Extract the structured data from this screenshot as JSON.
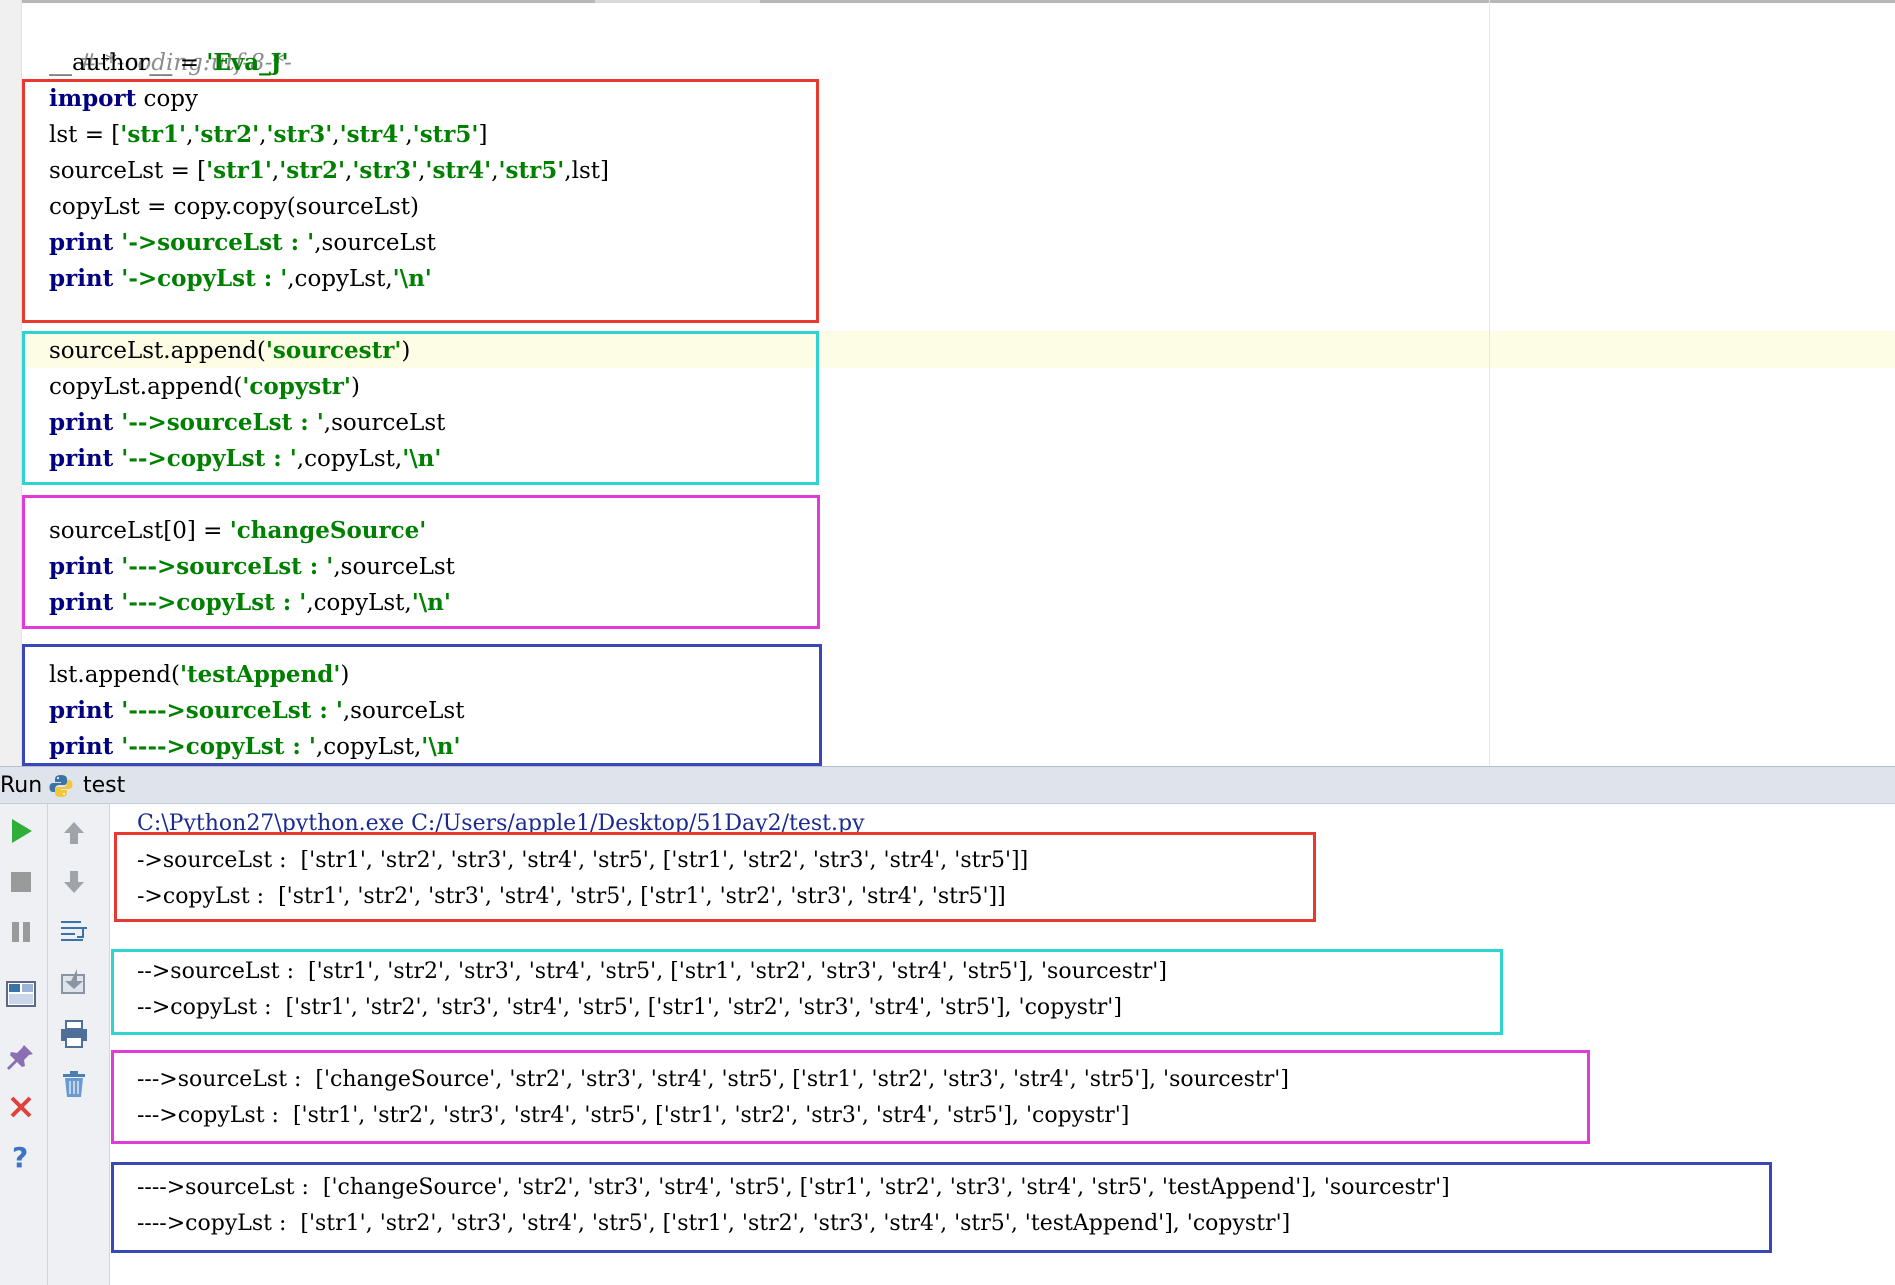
{
  "editor": {
    "line1": "#-*-coding:utf-8-*-",
    "line2": {
      "ident": "__author__ = ",
      "string": "'Eva_J'"
    },
    "block1": {
      "l1": {
        "kw": "import",
        "rest": " copy"
      },
      "l2": {
        "a": "lst = [",
        "s1": "'str1'",
        "c1": ",",
        "s2": "'str2'",
        "c2": ",",
        "s3": "'str3'",
        "c3": ",",
        "s4": "'str4'",
        "c4": ",",
        "s5": "'str5'",
        "b": "]"
      },
      "l3": {
        "a": "sourceLst = [",
        "s1": "'str1'",
        "c1": ",",
        "s2": "'str2'",
        "c2": ",",
        "s3": "'str3'",
        "c3": ",",
        "s4": "'str4'",
        "c4": ",",
        "s5": "'str5'",
        "b": ",lst]"
      },
      "l4": "copyLst = copy.copy(sourceLst)",
      "l5": {
        "kw": "print",
        "str": " '->sourceLst : '",
        "rest": ",sourceLst"
      },
      "l6": {
        "kw": "print",
        "str": " '->copyLst : '",
        "rest": ",copyLst,",
        "nl": "'\\n'"
      }
    },
    "block2": {
      "l1": {
        "a": "sourceLst.append(",
        "s": "'sourcestr'",
        "b": ")"
      },
      "l2": {
        "a": "copyLst.append(",
        "s": "'copystr'",
        "b": ")"
      },
      "l3": {
        "kw": "print",
        "str": " '-->sourceLst : '",
        "rest": ",sourceLst"
      },
      "l4": {
        "kw": "print",
        "str": " '-->copyLst : '",
        "rest": ",copyLst,",
        "nl": "'\\n'"
      }
    },
    "block3": {
      "l1": {
        "a": "sourceLst[0] = ",
        "s": "'changeSource'"
      },
      "l2": {
        "kw": "print",
        "str": " '--->sourceLst : '",
        "rest": ",sourceLst"
      },
      "l3": {
        "kw": "print",
        "str": " '--->copyLst : '",
        "rest": ",copyLst,",
        "nl": "'\\n'"
      }
    },
    "block4": {
      "l1": {
        "a": "lst.append(",
        "s": "'testAppend'",
        "b": ")"
      },
      "l2": {
        "kw": "print",
        "str": " '---->sourceLst : '",
        "rest": ",sourceLst"
      },
      "l3": {
        "kw": "print",
        "str": " '---->copyLst : '",
        "rest": ",copyLst,",
        "nl": "'\\n'"
      }
    }
  },
  "run_panel": {
    "label": "Run",
    "tab_name": "test",
    "tab_icon": "python-icon",
    "toolbar_left": [
      "run-icon",
      "stop-icon",
      "pause-icon",
      "layout-icon",
      "pin-icon",
      "close-icon",
      "help-icon"
    ],
    "toolbar_right": [
      "up-arrow-icon",
      "down-arrow-icon",
      "soft-wrap-icon",
      "scroll-to-end-icon",
      "print-icon",
      "trash-icon"
    ]
  },
  "console": {
    "command": "C:\\Python27\\python.exe C:/Users/apple1/Desktop/51Day2/test.py",
    "output": [
      "->sourceLst :  ['str1', 'str2', 'str3', 'str4', 'str5', ['str1', 'str2', 'str3', 'str4', 'str5']]",
      "->copyLst :  ['str1', 'str2', 'str3', 'str4', 'str5', ['str1', 'str2', 'str3', 'str4', 'str5']]",
      "-->sourceLst :  ['str1', 'str2', 'str3', 'str4', 'str5', ['str1', 'str2', 'str3', 'str4', 'str5'], 'sourcestr']",
      "-->copyLst :  ['str1', 'str2', 'str3', 'str4', 'str5', ['str1', 'str2', 'str3', 'str4', 'str5'], 'copystr']",
      "--->sourceLst :  ['changeSource', 'str2', 'str3', 'str4', 'str5', ['str1', 'str2', 'str3', 'str4', 'str5'], 'sourcestr']",
      "--->copyLst :  ['str1', 'str2', 'str3', 'str4', 'str5', ['str1', 'str2', 'str3', 'str4', 'str5'], 'copystr']",
      "---->sourceLst :  ['changeSource', 'str2', 'str3', 'str4', 'str5', ['str1', 'str2', 'str3', 'str4', 'str5', 'testAppend'], 'sourcestr']",
      "---->copyLst :  ['str1', 'str2', 'str3', 'str4', 'str5', ['str1', 'str2', 'str3', 'str4', 'str5', 'testAppend'], 'copystr']"
    ]
  },
  "colors": {
    "box1": "#e8382f",
    "box2": "#2ed3d2",
    "box3": "#e23ad6",
    "box4": "#3a47b6",
    "keyword": "#000080",
    "string": "#008000",
    "comment": "#8c8c8c",
    "caret_row": "#fdfce4"
  }
}
